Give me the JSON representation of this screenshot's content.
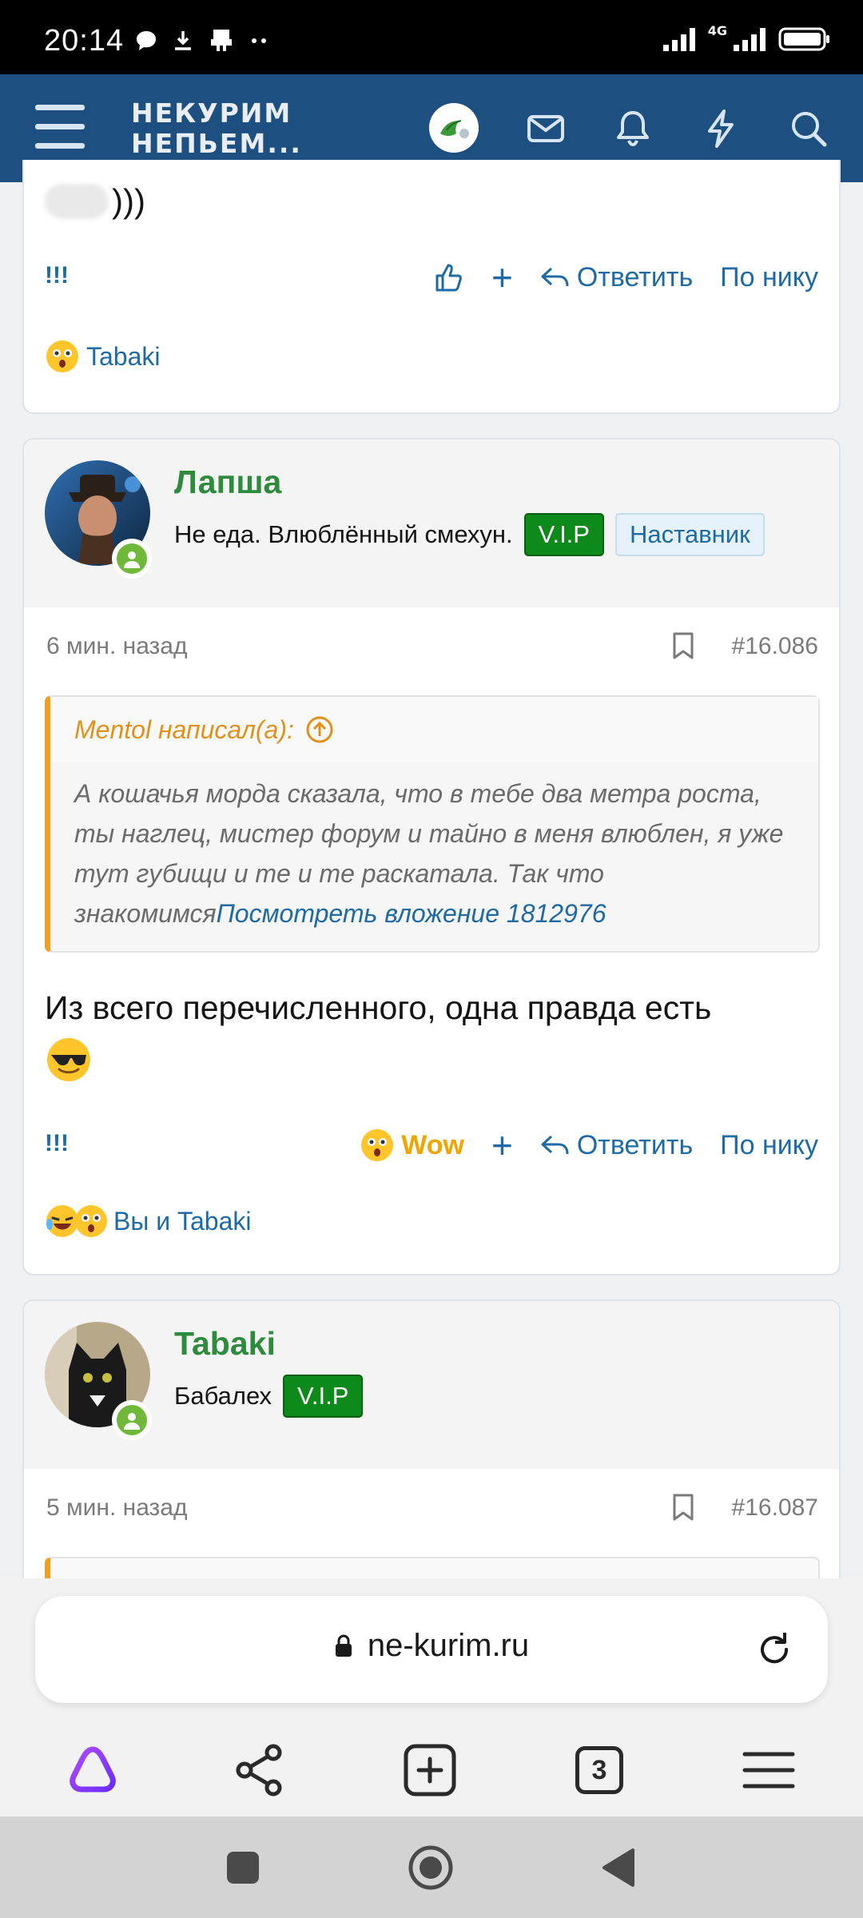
{
  "status_bar": {
    "time": "20:14",
    "network": "4G"
  },
  "header": {
    "logo_line1": "НЕКУРИМ",
    "logo_line2": "НЕПЬЕМ..."
  },
  "post_prev": {
    "partial_text": ")))",
    "excl": "!!!",
    "plus": "+",
    "reply": "Ответить",
    "by_nick": "По нику",
    "reaction_users": "Tabaki"
  },
  "post1": {
    "username": "Лапша",
    "user_title": "Не еда. Влюблённый смехун.",
    "badge_vip": "V.I.P",
    "badge_mentor": "Наставник",
    "time": "6 мин. назад",
    "post_number": "#16.086",
    "quote_author": "Mentol написал(а):",
    "quote_text": "А кошачья морда сказала, что в тебе два метра роста, ты наглец, мистер форум и тайно в меня влюблен, я уже тут губищи и те и те раскатала. Так что знакомимся",
    "quote_link": "Посмотреть вложение 1812976",
    "body": "Из всего перечисленного, одна правда есть",
    "excl": "!!!",
    "reaction_label": "Wow",
    "plus": "+",
    "reply": "Ответить",
    "by_nick": "По нику",
    "reaction_users": "Вы и Tabaki"
  },
  "post2": {
    "username": "Tabaki",
    "user_title": "Бабалех",
    "badge_vip": "V.I.P",
    "time": "5 мин. назад",
    "post_number": "#16.087"
  },
  "browser": {
    "url": "ne-kurim.ru",
    "tab_count": "3"
  },
  "colors": {
    "header_bg": "#1d5080",
    "link": "#1d6aa5",
    "username": "#2e8a3d",
    "vip": "#0e8a1a",
    "quote_accent": "#f0a020"
  }
}
